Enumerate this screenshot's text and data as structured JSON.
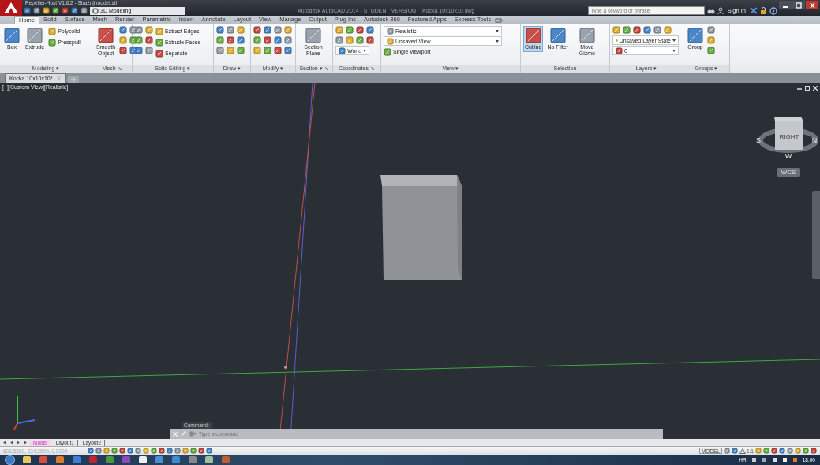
{
  "app_title": "Repetier-Host V1.6.2 - Stražnji model.stl",
  "workspace": "3D Modeling",
  "window": {
    "title": "Autodesk AutoCAD 2014 - STUDENT VERSION    Kocka 10x10x10.dwg"
  },
  "search": {
    "placeholder": "Type a keyword or phrase"
  },
  "sign_in": "Sign In",
  "ribbon_tabs": [
    {
      "label": "Home",
      "selected": true
    },
    {
      "label": "Solid",
      "selected": false
    },
    {
      "label": "Surface",
      "selected": false
    },
    {
      "label": "Mesh",
      "selected": false
    },
    {
      "label": "Render",
      "selected": false
    },
    {
      "label": "Parametric",
      "selected": false
    },
    {
      "label": "Insert",
      "selected": false
    },
    {
      "label": "Annotate",
      "selected": false
    },
    {
      "label": "Layout",
      "selected": false
    },
    {
      "label": "View",
      "selected": false
    },
    {
      "label": "Manage",
      "selected": false
    },
    {
      "label": "Output",
      "selected": false
    },
    {
      "label": "Plug-ins",
      "selected": false
    },
    {
      "label": "Autodesk 360",
      "selected": false
    },
    {
      "label": "Featured Apps",
      "selected": false
    },
    {
      "label": "Express Tools",
      "selected": false
    }
  ],
  "ribbon_panels": [
    {
      "title": "Modeling ▾",
      "tools": [
        {
          "kind": "large",
          "label": "Box"
        },
        {
          "kind": "large",
          "label": "Extrude"
        },
        {
          "kind": "small",
          "label": "Polysolid"
        },
        {
          "kind": "small",
          "label": "Presspull"
        }
      ]
    },
    {
      "title": "Mesh ↘",
      "tools": [
        {
          "kind": "large",
          "label": "Smooth Object"
        }
      ]
    },
    {
      "title": "Solid Editing ▾",
      "tools": [
        {
          "kind": "small",
          "label": "Extract Edges"
        },
        {
          "kind": "small",
          "label": "Extrude Faces"
        },
        {
          "kind": "small",
          "label": "Separate"
        }
      ]
    },
    {
      "title": "Draw ▾"
    },
    {
      "title": "Modify ▾"
    },
    {
      "title": "Section ▾ ↘",
      "tools": [
        {
          "kind": "large",
          "label": "Section Plane"
        }
      ]
    },
    {
      "title": "Coordinates ↘",
      "tools": [
        {
          "kind": "dropdown",
          "label": "World"
        }
      ]
    },
    {
      "title": "View ▾",
      "tools": [
        {
          "kind": "dropdown",
          "label": "Realistic"
        },
        {
          "kind": "dropdown",
          "label": "Unsaved View"
        },
        {
          "kind": "small",
          "label": "Single viewport"
        }
      ]
    },
    {
      "title": "Selection",
      "tools": [
        {
          "kind": "large",
          "label": "Culling",
          "on": true
        },
        {
          "kind": "large",
          "label": "No Filter",
          "on": false
        },
        {
          "kind": "large",
          "label": "Move Gizmo",
          "on": false
        }
      ]
    },
    {
      "title": "Layers ▾",
      "tools": [
        {
          "kind": "dropdown",
          "label": "Unsaved Layer State"
        },
        {
          "kind": "dropdown",
          "label": "0"
        }
      ]
    },
    {
      "title": "Groups ▾",
      "tools": [
        {
          "kind": "large",
          "label": "Group"
        }
      ]
    }
  ],
  "document_tabs": [
    {
      "label": "Kocka 10x10x10*",
      "selected": true
    }
  ],
  "viewport": {
    "label": "[−][Custom View][Realistic]",
    "viewcube_face": "RIGHT",
    "compass": [
      "S",
      "N",
      "W"
    ],
    "coordinate_system": "WCS"
  },
  "command": {
    "history": "Command:",
    "placeholder": "Type a command"
  },
  "layout_tabs": [
    {
      "label": "Model",
      "selected": true
    },
    {
      "label": "Layout1",
      "selected": false
    },
    {
      "label": "Layout2",
      "selected": false
    }
  ],
  "status_bar": {
    "coordinates": "803.5260, 224.2540, 0.0000",
    "space": "MODEL",
    "scale": "1:1"
  },
  "taskbar": {
    "language": "HR",
    "clock": "18:00"
  }
}
